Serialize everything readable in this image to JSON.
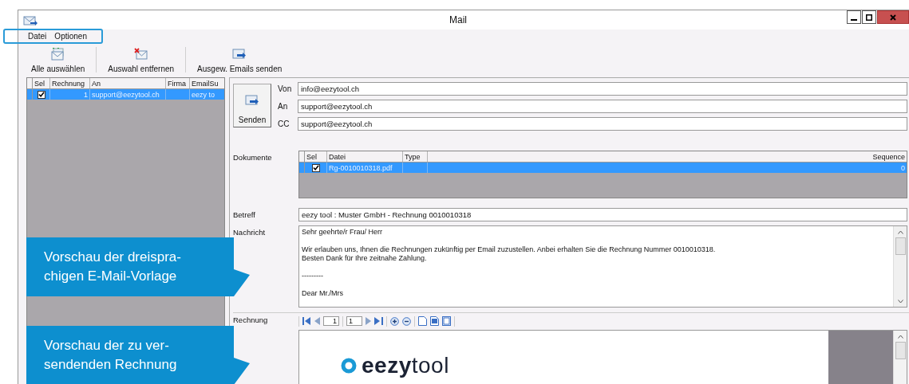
{
  "window": {
    "title": "Mail"
  },
  "menu": [
    {
      "label": "Datei"
    },
    {
      "label": "Optionen"
    }
  ],
  "toolbar": [
    {
      "kind": "select_all",
      "label": "Alle auswählen"
    },
    {
      "kind": "remove",
      "label": "Auswahl entfernen"
    },
    {
      "kind": "send",
      "label": "Ausgew. Emails senden"
    }
  ],
  "invoices": {
    "columns": [
      "Sel",
      "Rechnung",
      "An",
      "Firma",
      "EmailSu"
    ],
    "rows": [
      {
        "selected": true,
        "checked": true,
        "rechnung": "1",
        "an": "support@eezytool.ch",
        "column_5": "eezy to"
      }
    ]
  },
  "mail": {
    "send_button": "Senden",
    "fields": [
      {
        "label": "Von",
        "value": "info@eezytool.ch"
      },
      {
        "label": "An",
        "value": "support@eezytool.ch"
      },
      {
        "label": "CC",
        "value": "support@eezytool.ch"
      }
    ],
    "documents": {
      "label": "Dokumente",
      "columns": [
        "Sel",
        "Datei",
        "Type",
        "Sequence"
      ],
      "rows": [
        {
          "selected": true,
          "checked": true,
          "datei": "Rg-0010010318.pdf",
          "sequence": "0"
        }
      ]
    },
    "subject": {
      "label": "Betreff",
      "value": "eezy tool : Muster GmbH - Rechnung 0010010318"
    },
    "message": {
      "label": "Nachricht",
      "paragraphs": [
        "Sehr geehrte/r Frau/ Herr",
        "Wir erlauben uns, Ihnen die Rechnungen zukünftig per Email zuzustellen. Anbei erhalten Sie die Rechnung Nummer 0010010318.\nBesten Dank für Ihre zeitnahe Zahlung.",
        "---------",
        "Dear Mr./Mrs"
      ]
    },
    "invoice": {
      "label": "Rechnung",
      "page": "1",
      "total": "1",
      "logo": "**eezy**tool"
    }
  },
  "callouts": [
    {
      "text": "Vorschau der dreispra-\nchigen E-Mail-Vorlage"
    },
    {
      "text": "Vorschau der zu ver-\nsendenden Rechnung"
    }
  ]
}
